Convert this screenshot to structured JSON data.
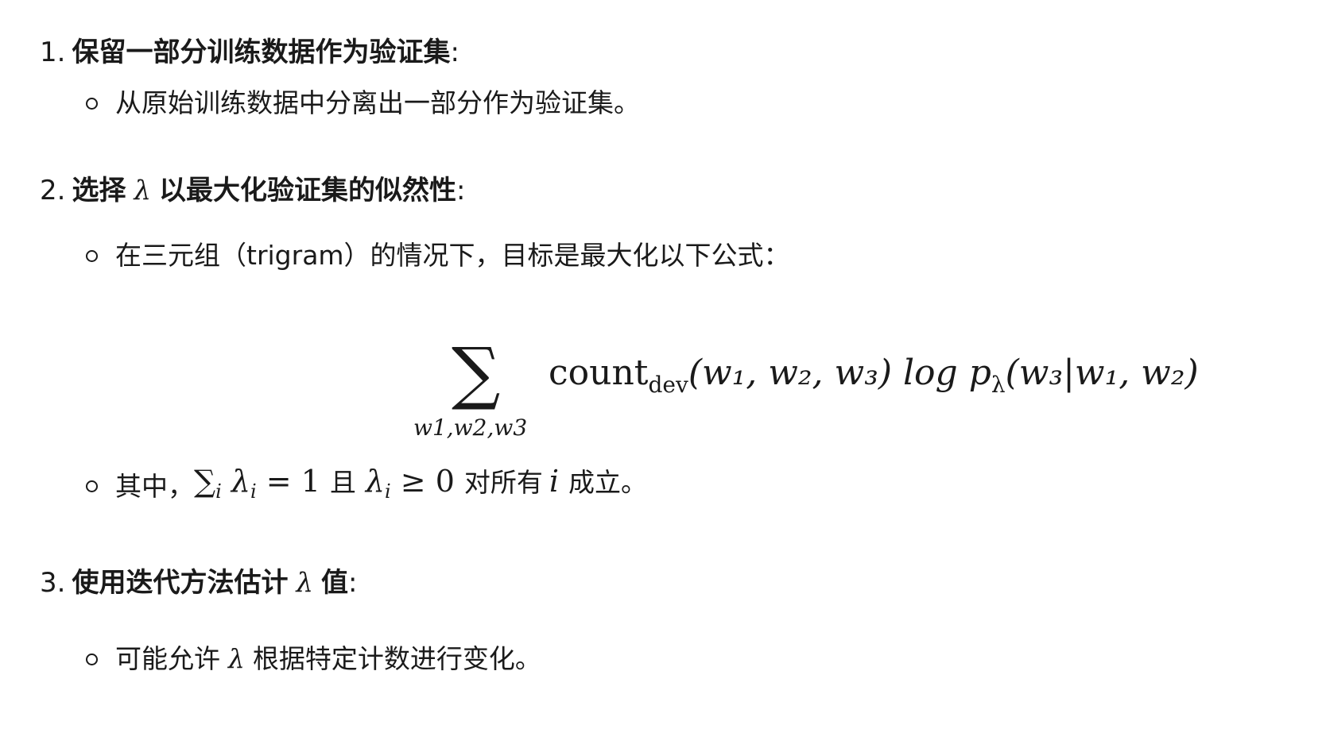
{
  "items": [
    {
      "number": "1.",
      "title": "保留一部分训练数据作为验证集",
      "colon": ":",
      "bullets": [
        "从原始训练数据中分离出一部分作为验证集。"
      ]
    },
    {
      "number": "2.",
      "title_part1": "选择",
      "lambda": "λ",
      "title_part2": "以最大化验证集的似然性",
      "colon": ":",
      "bullet1": "在三元组（trigram）的情况下，目标是最大化以下公式：",
      "formula": {
        "sum_symbol": "∑",
        "sum_index": "w1,w2,w3",
        "count": "count",
        "count_sub": "dev",
        "args": "(w₁, w₂, w₃) log p",
        "p_sub": "λ",
        "cond": "(w₃|w₁, w₂)"
      },
      "bullet2": {
        "prefix": "其中，",
        "sum": "∑",
        "sum_sub": "i",
        "eq1": "λ",
        "eq1_sub": "i",
        "eq1_rhs": "= 1",
        "and": "且",
        "eq2": "λ",
        "eq2_sub": "i",
        "eq2_rhs": "≥ 0",
        "for_all": "对所有",
        "var": "i",
        "suffix": "成立。"
      }
    },
    {
      "number": "3.",
      "title_part1": "使用迭代方法估计",
      "lambda": "λ",
      "title_part2": "值",
      "colon": ":",
      "bullet_prefix": "可能允许",
      "bullet_lambda": "λ",
      "bullet_suffix": "根据特定计数进行变化。"
    }
  ]
}
